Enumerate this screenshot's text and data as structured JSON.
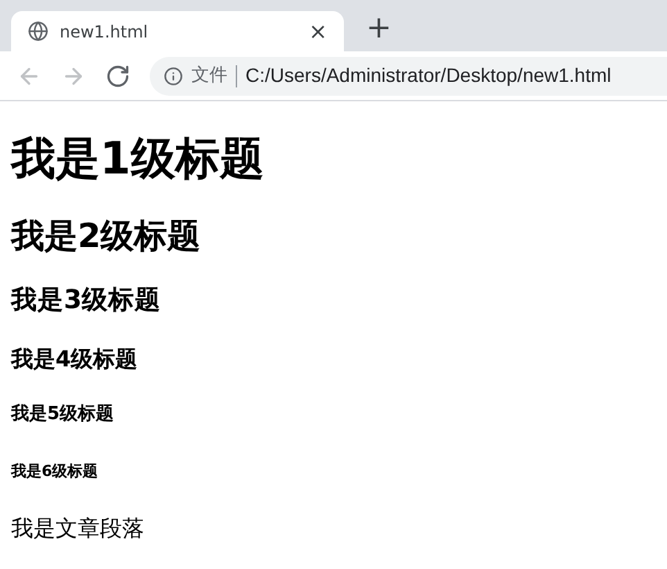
{
  "tab": {
    "title": "new1.html",
    "close": "×",
    "new_tab": "+"
  },
  "nav_buttons": [
    {
      "kind": "back",
      "disabled": true
    },
    {
      "kind": "forward",
      "disabled": true
    },
    {
      "kind": "reload",
      "disabled": false
    }
  ],
  "address_bar": {
    "scheme_label": "文件",
    "url": "C:/Users/Administrator/Desktop/new1.html"
  },
  "content": [
    {
      "kind": "h1",
      "text": "我是1级标题"
    },
    {
      "kind": "h2",
      "text": "我是2级标题"
    },
    {
      "kind": "h3",
      "text": "我是3级标题"
    },
    {
      "kind": "h4",
      "text": "我是4级标题"
    },
    {
      "kind": "h5",
      "text": "我是5级标题"
    },
    {
      "kind": "h6",
      "text": "我是6级标题"
    },
    {
      "kind": "p",
      "text": "我是文章段落"
    }
  ]
}
